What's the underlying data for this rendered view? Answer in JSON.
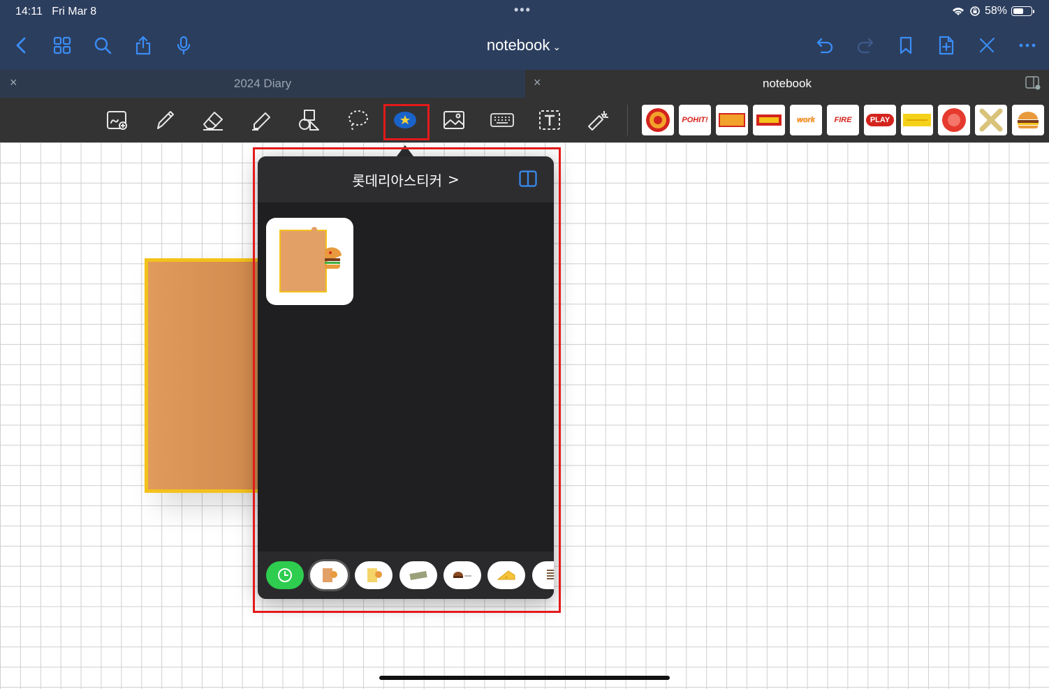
{
  "status_bar": {
    "time": "14:11",
    "date": "Fri Mar 8",
    "battery": "58%",
    "battery_level": 0.58
  },
  "nav": {
    "title": "notebook",
    "title_chevron": "⌄"
  },
  "tabs": [
    {
      "label": "2024 Diary",
      "close": "×"
    },
    {
      "label": "notebook",
      "close": "×"
    }
  ],
  "toolbar": {
    "tools": [
      "zoom-window-tool",
      "pen-tool",
      "eraser-tool",
      "highlighter-tool",
      "shapes-tool",
      "lasso-tool",
      "sticker-tool",
      "image-tool",
      "keyboard-tool",
      "text-tool",
      "laser-pointer-tool"
    ],
    "favorite_stickers": [
      "",
      "POHIT!",
      "",
      "",
      "work",
      "FIRE",
      "PLAY",
      "",
      "",
      "",
      ""
    ]
  },
  "popover": {
    "title": "롯데리아스티커",
    "title_chevron": ">",
    "pack_count": 7
  },
  "colors": {
    "accent": "#1a7cf5",
    "highlight": "#e31a1a",
    "nav_bg": "#2c3e5e"
  }
}
